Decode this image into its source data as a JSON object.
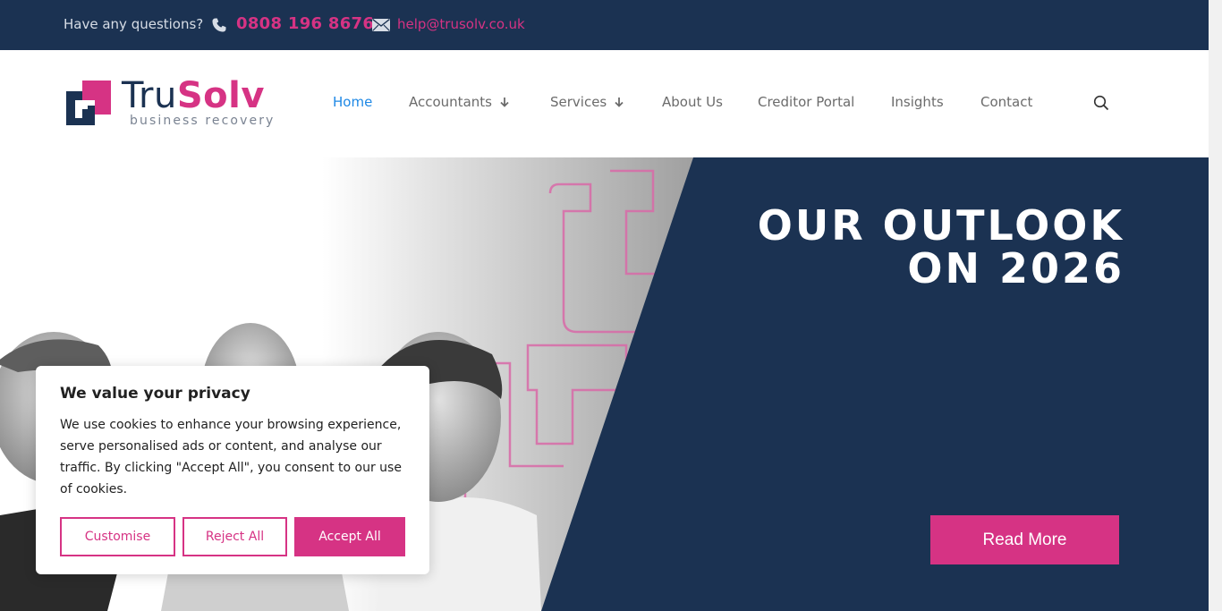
{
  "topbar": {
    "question": "Have any questions?",
    "phone": "0808 196 8676",
    "email": "help@trusolv.co.uk"
  },
  "logo": {
    "name_part1": "Tru",
    "name_part2": "Solv",
    "tagline": "business recovery"
  },
  "nav": [
    {
      "label": "Home",
      "active": true
    },
    {
      "label": "Accountants",
      "dropdown": true
    },
    {
      "label": "Services",
      "dropdown": true
    },
    {
      "label": "About Us"
    },
    {
      "label": "Creditor Portal"
    },
    {
      "label": "Insights"
    },
    {
      "label": "Contact"
    }
  ],
  "hero": {
    "headline_line1": "OUR OUTLOOK",
    "headline_line2": "ON 2026",
    "cta": "Read More"
  },
  "cookie": {
    "title": "We value your privacy",
    "body": "We use cookies to enhance your browsing experience, serve personalised ads or content, and analyse our traffic. By clicking \"Accept All\", you consent to our use of cookies.",
    "customise": "Customise",
    "reject": "Reject All",
    "accept": "Accept All"
  },
  "colors": {
    "navy": "#1b3252",
    "pink": "#d63384",
    "nav_active": "#1e88e5"
  },
  "icons": [
    "phone-icon",
    "mail-icon",
    "chevron-down-icon",
    "search-icon"
  ]
}
